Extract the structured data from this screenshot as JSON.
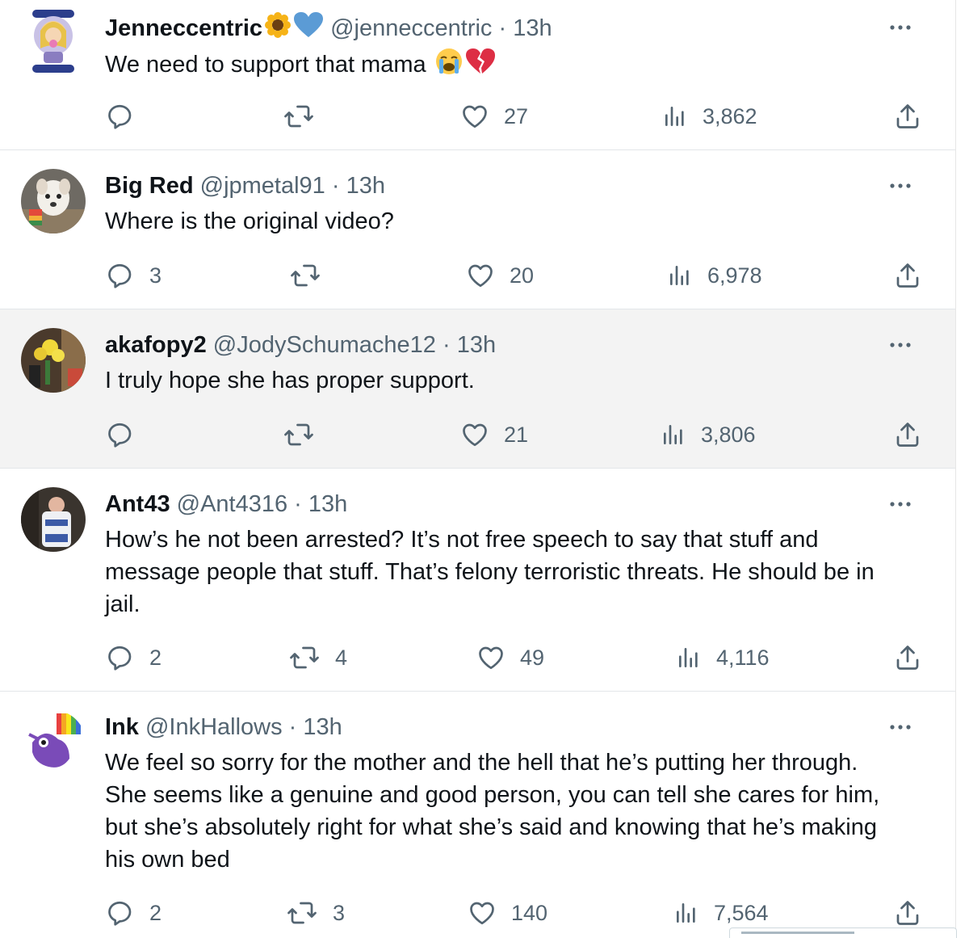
{
  "tweets": [
    {
      "name": "Jenneccentric",
      "name_emojis": [
        "sunflower",
        "blue-heart"
      ],
      "handle": "@jenneccentric",
      "time": "13h",
      "text": "We need to support that mama",
      "text_emojis": [
        "loudly-crying-face",
        "broken-heart"
      ],
      "replies": "",
      "retweets": "",
      "likes": "27",
      "views": "3,862",
      "highlighted": false
    },
    {
      "name": "Big Red",
      "handle": "@jpmetal91",
      "time": "13h",
      "text": "Where is the original video?",
      "replies": "3",
      "retweets": "",
      "likes": "20",
      "views": "6,978",
      "highlighted": false
    },
    {
      "name": "akafopy2",
      "handle": "@JodySchumache12",
      "time": "13h",
      "text": "I truly hope she has proper support.",
      "replies": "",
      "retweets": "",
      "likes": "21",
      "views": "3,806",
      "highlighted": true
    },
    {
      "name": "Ant43",
      "handle": "@Ant4316",
      "time": "13h",
      "text_lines": [
        "How’s he not been arrested? It’s not free speech to say that stuff and",
        "message people that stuff. That’s felony terroristic threats. He should be in",
        "jail."
      ],
      "replies": "2",
      "retweets": "4",
      "likes": "49",
      "views": "4,116",
      "highlighted": false
    },
    {
      "name": "Ink",
      "handle": "@InkHallows",
      "time": "13h",
      "text_lines": [
        "We feel so sorry for the mother and the hell that he’s putting her through.",
        "She seems like a genuine and good person, you can tell she cares for him,",
        "but she’s absolutely right for what she’s said and knowing that he’s making",
        "his own bed"
      ],
      "replies": "2",
      "retweets": "3",
      "likes": "140",
      "views": "7,564",
      "highlighted": false
    }
  ],
  "icons": {
    "reply": "reply-icon",
    "retweet": "retweet-icon",
    "like": "heart-icon",
    "views": "views-icon",
    "share": "share-icon",
    "more": "more-icon"
  },
  "colors": {
    "text": "#0f1419",
    "secondary": "#536471",
    "highlight_bg": "#f3f3f3",
    "divider": "#e3e6e9",
    "verified_blue_heart": "#5b9bd5"
  }
}
